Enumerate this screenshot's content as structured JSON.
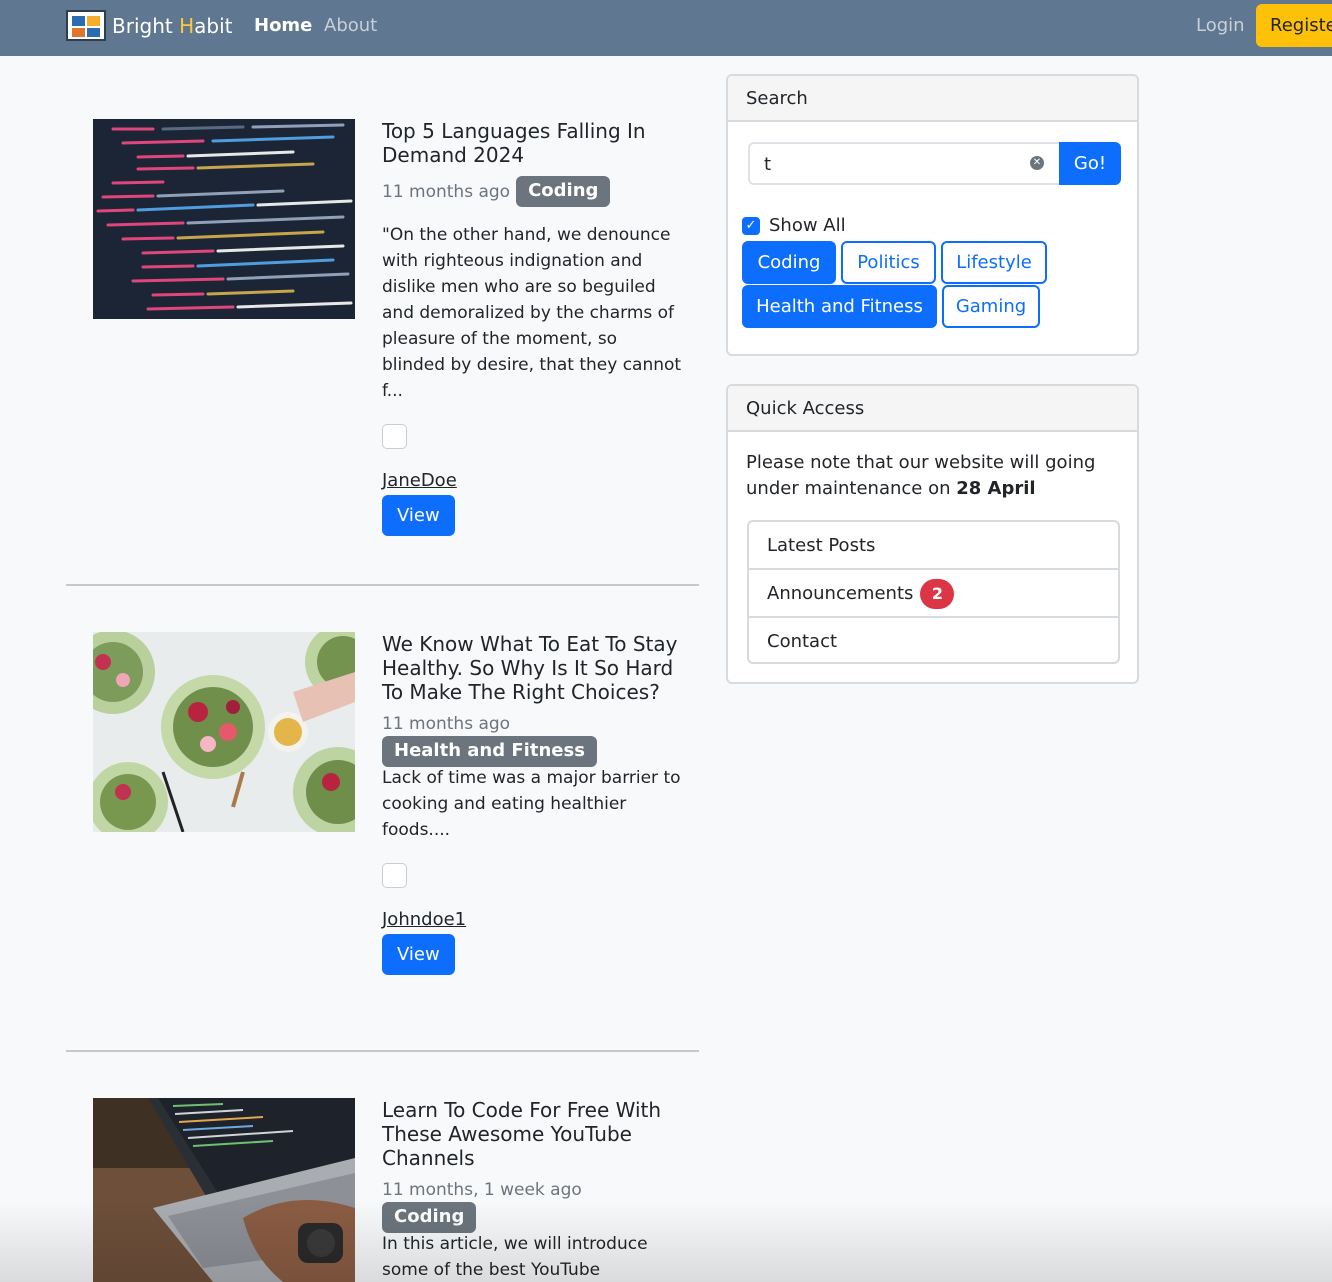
{
  "nav": {
    "brand_prefix": "Bright ",
    "brand_h": "H",
    "brand_suffix": "abit",
    "home": "Home",
    "about": "About",
    "login": "Login",
    "register": "Register"
  },
  "posts": [
    {
      "title": "Top 5 Languages Falling In Demand 2024",
      "time": "11 months ago",
      "category": "Coding",
      "excerpt": "\"On the other hand, we denounce with righteous indignation and dislike men who are so beguiled and demoralized by the charms of pleasure of the moment, so blinded by desire, that they cannot f...",
      "author": "JaneDoe",
      "view": "View"
    },
    {
      "title": "We Know What To Eat To Stay Healthy. So Why Is It So Hard To Make The Right Choices?",
      "time": "11 months ago",
      "category": "Health and Fitness",
      "excerpt": "Lack of time was a major barrier to cooking and eating healthier foods....",
      "author": "Johndoe1",
      "view": "View"
    },
    {
      "title": "Learn To Code For Free With These Awesome YouTube Channels",
      "time": "11 months, 1 week ago",
      "category": "Coding",
      "excerpt": "In this article, we will introduce some of the best YouTube"
    }
  ],
  "search": {
    "header": "Search",
    "value": "t",
    "go": "Go!",
    "show_all": "Show All",
    "categories": [
      "Coding",
      "Politics",
      "Lifestyle",
      "Health and Fitness",
      "Gaming"
    ]
  },
  "quick": {
    "header": "Quick Access",
    "notice_text": "Please note that our website will going under maintenance on ",
    "notice_date": "28 April",
    "items": [
      "Latest Posts",
      "Announcements",
      "Contact"
    ],
    "announcements_count": "2"
  },
  "colors": {
    "navbar": "#5f7790",
    "primary": "#0d6efd",
    "warning": "#ffc107",
    "secondary": "#6c757d",
    "danger": "#dc3545"
  }
}
